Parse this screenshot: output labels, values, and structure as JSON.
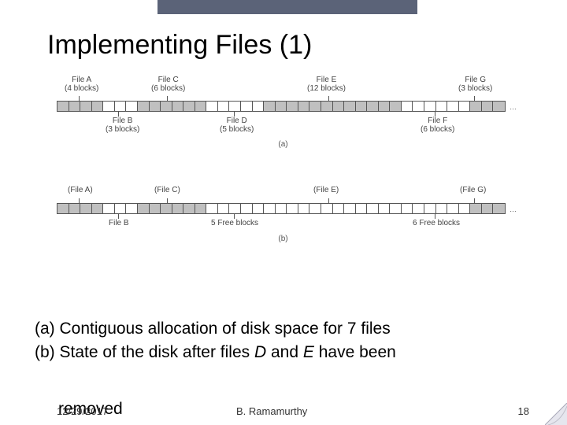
{
  "title": "Implementing Files (1)",
  "fig_a": {
    "top_labels": [
      {
        "name": "File A",
        "blocks": "(4 blocks)"
      },
      {
        "name": "File C",
        "blocks": "(6 blocks)"
      },
      {
        "name": "File E",
        "blocks": "(12 blocks)"
      },
      {
        "name": "File G",
        "blocks": "(3 blocks)"
      }
    ],
    "bot_labels": [
      {
        "name": "File B",
        "blocks": "(3 blocks)"
      },
      {
        "name": "File D",
        "blocks": "(5 blocks)"
      },
      {
        "name": "File F",
        "blocks": "(6 blocks)"
      }
    ],
    "caption": "(a)"
  },
  "fig_b": {
    "top_labels": [
      {
        "name": "(File A)"
      },
      {
        "name": "(File C)"
      },
      {
        "name": "(File E)"
      },
      {
        "name": "(File G)"
      }
    ],
    "bot_labels": [
      {
        "name": "File B"
      },
      {
        "name": "5 Free blocks"
      },
      {
        "name": "6 Free blocks"
      }
    ],
    "caption": "(b)"
  },
  "caption_a": "(a) Contiguous allocation of disk space for 7 files",
  "caption_b_pre": "(b) State of the disk after files ",
  "caption_b_d": "D",
  "caption_b_mid": " and ",
  "caption_b_e": "E",
  "caption_b_post": " have been",
  "removed_line": "removed",
  "footer": {
    "date": "12/29/2017",
    "author": "B. Ramamurthy",
    "page": "18"
  },
  "ellipsis": "…",
  "chart_data": [
    {
      "type": "table",
      "title": "Contiguous allocation of disk space for 7 files (a)",
      "files": [
        {
          "name": "File A",
          "start": 0,
          "length": 4
        },
        {
          "name": "File B",
          "start": 4,
          "length": 3
        },
        {
          "name": "File C",
          "start": 7,
          "length": 6
        },
        {
          "name": "File D",
          "start": 13,
          "length": 5
        },
        {
          "name": "File E",
          "start": 18,
          "length": 12
        },
        {
          "name": "File F",
          "start": 30,
          "length": 6
        },
        {
          "name": "File G",
          "start": 36,
          "length": 3
        }
      ],
      "total_blocks_shown": 39
    },
    {
      "type": "table",
      "title": "State of the disk after files D and E have been removed (b)",
      "files": [
        {
          "name": "File A",
          "start": 0,
          "length": 4
        },
        {
          "name": "File B",
          "start": 4,
          "length": 3
        },
        {
          "name": "File C",
          "start": 7,
          "length": 6
        },
        {
          "name": "Free",
          "start": 13,
          "length": 5
        },
        {
          "name": "Free",
          "start": 18,
          "length": 12
        },
        {
          "name": "File F",
          "start": 30,
          "length": 6
        },
        {
          "name": "File G",
          "start": 36,
          "length": 3
        }
      ],
      "bottom_annotations": [
        {
          "label": "File B"
        },
        {
          "label": "5 Free blocks"
        },
        {
          "label": "6 Free blocks"
        }
      ],
      "total_blocks_shown": 39
    }
  ]
}
